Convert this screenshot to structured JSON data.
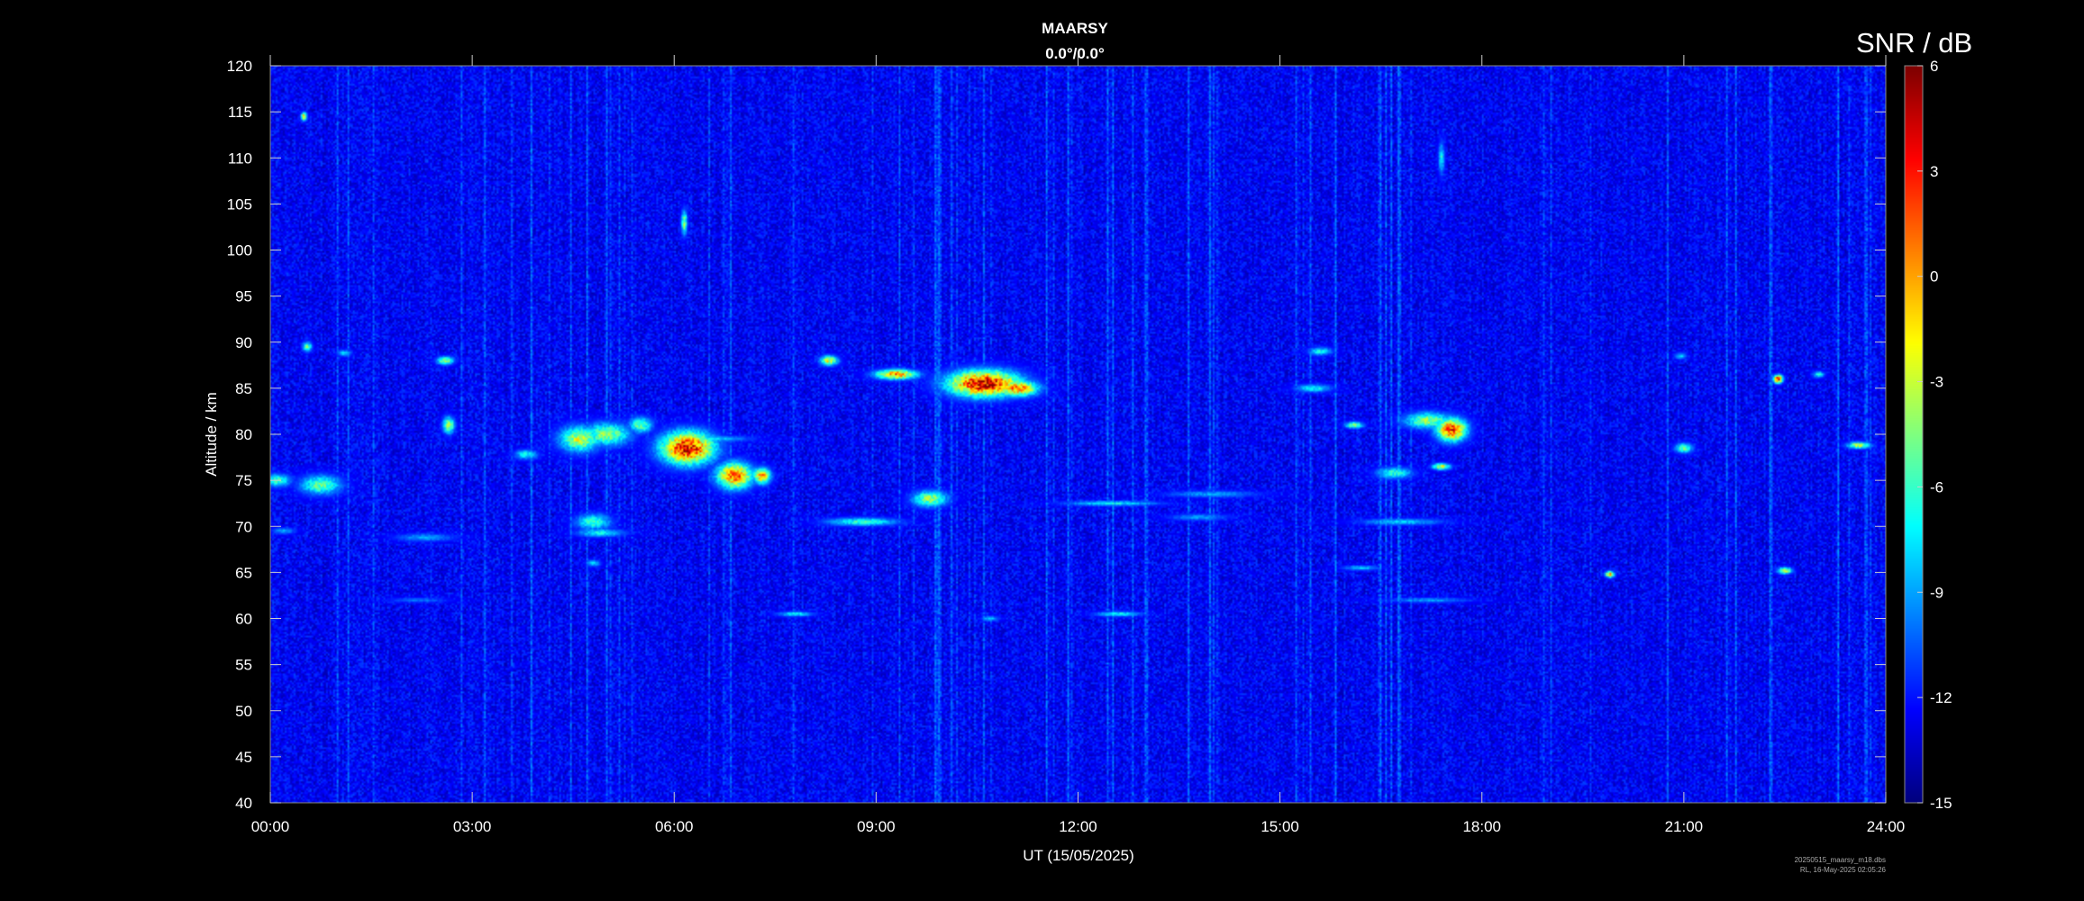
{
  "chart_data": {
    "type": "heatmap",
    "title": "MAARSY",
    "subtitle": "0.0°/0.0°",
    "xlabel": "UT (15/05/2025)",
    "ylabel": "Altitude / km",
    "colorbar_label": "SNR / dB",
    "xlim_hours": [
      0,
      24
    ],
    "ylim": [
      40,
      120
    ],
    "clim": [
      -15,
      6
    ],
    "x_ticks": [
      "00:00",
      "03:00",
      "06:00",
      "09:00",
      "12:00",
      "15:00",
      "18:00",
      "21:00",
      "24:00"
    ],
    "y_ticks": [
      40,
      45,
      50,
      55,
      60,
      65,
      70,
      75,
      80,
      85,
      90,
      95,
      100,
      105,
      110,
      115,
      120
    ],
    "colorbar_ticks": [
      -15,
      -12,
      -9,
      -6,
      -3,
      0,
      3,
      6
    ],
    "background_snr": -13,
    "echoes": [
      {
        "t": 0.1,
        "alt": 75.0,
        "w": 0.25,
        "h": 0.8,
        "snr": -6
      },
      {
        "t": 0.55,
        "alt": 89.5,
        "w": 0.08,
        "h": 0.6,
        "snr": -5
      },
      {
        "t": 0.75,
        "alt": 74.5,
        "w": 0.35,
        "h": 1.2,
        "snr": -5
      },
      {
        "t": 1.1,
        "alt": 88.8,
        "w": 0.12,
        "h": 0.4,
        "snr": -8
      },
      {
        "t": 0.2,
        "alt": 69.5,
        "w": 0.2,
        "h": 0.4,
        "snr": -9
      },
      {
        "t": 2.6,
        "alt": 88.0,
        "w": 0.15,
        "h": 0.5,
        "snr": -4
      },
      {
        "t": 2.65,
        "alt": 81.0,
        "w": 0.1,
        "h": 1.0,
        "snr": -3
      },
      {
        "t": 2.3,
        "alt": 68.8,
        "w": 0.5,
        "h": 0.5,
        "snr": -9
      },
      {
        "t": 2.2,
        "alt": 62.0,
        "w": 0.5,
        "h": 0.3,
        "snr": -10
      },
      {
        "t": 3.8,
        "alt": 77.8,
        "w": 0.2,
        "h": 0.6,
        "snr": -7
      },
      {
        "t": 4.6,
        "alt": 79.5,
        "w": 0.35,
        "h": 1.6,
        "snr": -3
      },
      {
        "t": 5.0,
        "alt": 80.0,
        "w": 0.4,
        "h": 1.4,
        "snr": -4
      },
      {
        "t": 5.5,
        "alt": 81.0,
        "w": 0.2,
        "h": 1.0,
        "snr": -5
      },
      {
        "t": 4.8,
        "alt": 70.5,
        "w": 0.3,
        "h": 1.0,
        "snr": -6
      },
      {
        "t": 4.9,
        "alt": 69.3,
        "w": 0.4,
        "h": 0.5,
        "snr": -7
      },
      {
        "t": 4.8,
        "alt": 66.0,
        "w": 0.12,
        "h": 0.4,
        "snr": -8
      },
      {
        "t": 6.2,
        "alt": 78.5,
        "w": 0.45,
        "h": 2.0,
        "snr": 4
      },
      {
        "t": 6.6,
        "alt": 79.5,
        "w": 0.6,
        "h": 0.4,
        "snr": -8
      },
      {
        "t": 6.9,
        "alt": 75.5,
        "w": 0.3,
        "h": 1.6,
        "snr": 2
      },
      {
        "t": 7.3,
        "alt": 75.5,
        "w": 0.15,
        "h": 1.0,
        "snr": 0
      },
      {
        "t": 8.3,
        "alt": 88.0,
        "w": 0.15,
        "h": 0.6,
        "snr": -2
      },
      {
        "t": 8.8,
        "alt": 70.5,
        "w": 0.6,
        "h": 0.5,
        "snr": -6
      },
      {
        "t": 7.8,
        "alt": 60.5,
        "w": 0.3,
        "h": 0.3,
        "snr": -7
      },
      {
        "t": 9.3,
        "alt": 86.5,
        "w": 0.35,
        "h": 0.6,
        "snr": 1
      },
      {
        "t": 9.8,
        "alt": 73.0,
        "w": 0.3,
        "h": 1.0,
        "snr": -4
      },
      {
        "t": 10.6,
        "alt": 85.5,
        "w": 0.6,
        "h": 1.6,
        "snr": 5
      },
      {
        "t": 11.1,
        "alt": 85.0,
        "w": 0.35,
        "h": 1.0,
        "snr": 1
      },
      {
        "t": 10.7,
        "alt": 60.0,
        "w": 0.15,
        "h": 0.3,
        "snr": -8
      },
      {
        "t": 12.5,
        "alt": 72.5,
        "w": 0.8,
        "h": 0.3,
        "snr": -7
      },
      {
        "t": 12.6,
        "alt": 60.5,
        "w": 0.4,
        "h": 0.3,
        "snr": -7
      },
      {
        "t": 14.0,
        "alt": 73.5,
        "w": 0.8,
        "h": 0.4,
        "snr": -9
      },
      {
        "t": 13.8,
        "alt": 71.0,
        "w": 0.5,
        "h": 0.4,
        "snr": -9
      },
      {
        "t": 15.6,
        "alt": 89.0,
        "w": 0.2,
        "h": 0.5,
        "snr": -7
      },
      {
        "t": 15.5,
        "alt": 85.0,
        "w": 0.3,
        "h": 0.5,
        "snr": -7
      },
      {
        "t": 16.1,
        "alt": 81.0,
        "w": 0.15,
        "h": 0.4,
        "snr": -4
      },
      {
        "t": 16.7,
        "alt": 75.8,
        "w": 0.3,
        "h": 0.7,
        "snr": -6
      },
      {
        "t": 16.8,
        "alt": 70.5,
        "w": 0.7,
        "h": 0.4,
        "snr": -8
      },
      {
        "t": 16.2,
        "alt": 65.5,
        "w": 0.3,
        "h": 0.3,
        "snr": -8
      },
      {
        "t": 17.2,
        "alt": 81.5,
        "w": 0.4,
        "h": 1.0,
        "snr": -4
      },
      {
        "t": 17.55,
        "alt": 80.5,
        "w": 0.25,
        "h": 1.4,
        "snr": 3
      },
      {
        "t": 17.4,
        "alt": 76.5,
        "w": 0.15,
        "h": 0.4,
        "snr": -2
      },
      {
        "t": 17.2,
        "alt": 62.0,
        "w": 0.7,
        "h": 0.3,
        "snr": -9
      },
      {
        "t": 19.9,
        "alt": 64.8,
        "w": 0.08,
        "h": 0.4,
        "snr": -1
      },
      {
        "t": 21.0,
        "alt": 78.5,
        "w": 0.15,
        "h": 0.6,
        "snr": -5
      },
      {
        "t": 20.95,
        "alt": 88.5,
        "w": 0.1,
        "h": 0.4,
        "snr": -8
      },
      {
        "t": 22.4,
        "alt": 86.0,
        "w": 0.08,
        "h": 0.5,
        "snr": 3
      },
      {
        "t": 22.5,
        "alt": 65.2,
        "w": 0.12,
        "h": 0.4,
        "snr": -2
      },
      {
        "t": 23.0,
        "alt": 86.5,
        "w": 0.1,
        "h": 0.4,
        "snr": -7
      },
      {
        "t": 23.6,
        "alt": 78.8,
        "w": 0.2,
        "h": 0.4,
        "snr": -3
      },
      {
        "t": 6.15,
        "alt": 103.0,
        "w": 0.05,
        "h": 1.5,
        "snr": -4
      },
      {
        "t": 17.4,
        "alt": 110.0,
        "w": 0.05,
        "h": 2.0,
        "snr": -7
      },
      {
        "t": 0.5,
        "alt": 114.5,
        "w": 0.05,
        "h": 0.5,
        "snr": -1
      }
    ]
  },
  "footnote": {
    "line1": "20250515_maarsy_m18.dbs",
    "line2": "RL, 16-May-2025 02:05:26"
  }
}
